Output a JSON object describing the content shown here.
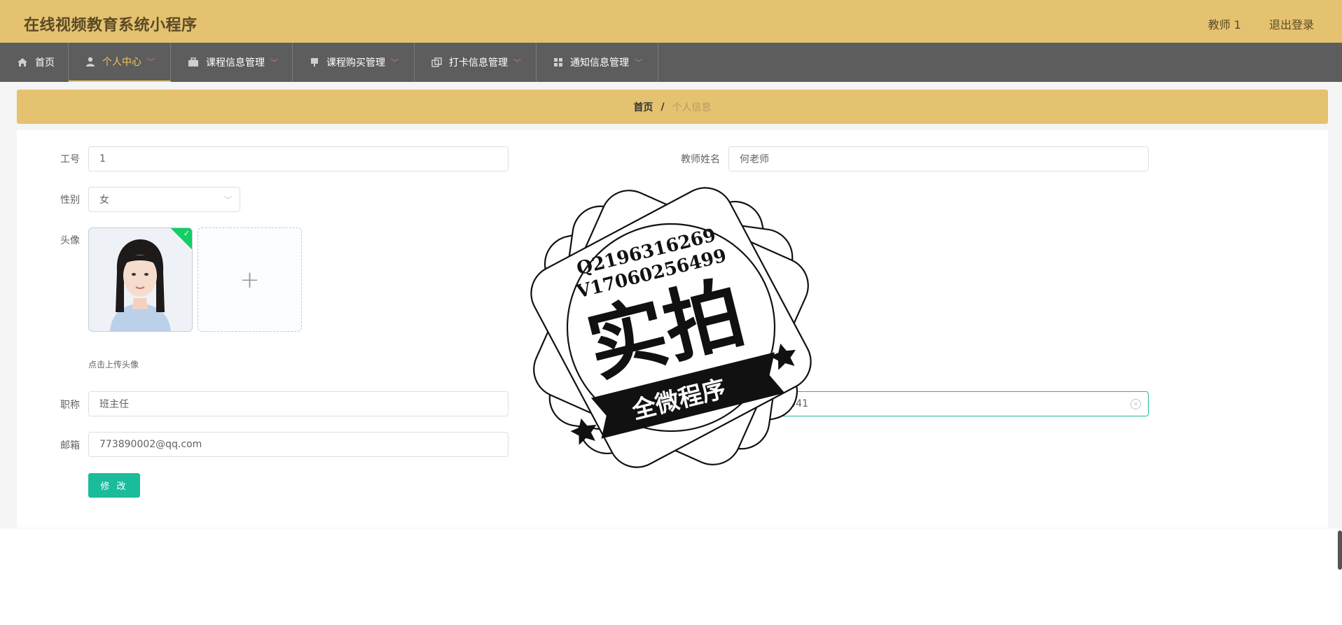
{
  "header": {
    "title": "在线视频教育系统小程序",
    "user": "教师 1",
    "logout": "退出登录"
  },
  "nav": [
    {
      "label": "首页",
      "icon": "home-icon"
    },
    {
      "label": "个人中心",
      "icon": "user-icon",
      "active": true
    },
    {
      "label": "课程信息管理",
      "icon": "briefcase-icon"
    },
    {
      "label": "课程购买管理",
      "icon": "monitor-icon"
    },
    {
      "label": "打卡信息管理",
      "icon": "copy-icon"
    },
    {
      "label": "通知信息管理",
      "icon": "grid-icon"
    }
  ],
  "breadcrumb": {
    "home": "首页",
    "sep": "/",
    "current": "个人信息"
  },
  "form": {
    "job_no": {
      "label": "工号",
      "value": "1"
    },
    "teacher_name": {
      "label": "教师姓名",
      "value": "何老师"
    },
    "gender": {
      "label": "性别",
      "value": "女"
    },
    "avatar": {
      "label": "头像",
      "hint": "点击上传头像"
    },
    "title": {
      "label": "职称",
      "value": "班主任"
    },
    "phone": {
      "value": "15214121441"
    },
    "email": {
      "label": "邮箱",
      "value": "773890002@qq.com"
    },
    "submit": "修 改"
  },
  "watermark": {
    "line1": "Q2196316269",
    "line2": "V17060256499",
    "big": "实拍",
    "ribbon": "全微程序"
  },
  "colors": {
    "header": "#e5c270",
    "nav": "#5d5d5d",
    "accent": "#1abc9c",
    "active": "#f0c55f"
  }
}
